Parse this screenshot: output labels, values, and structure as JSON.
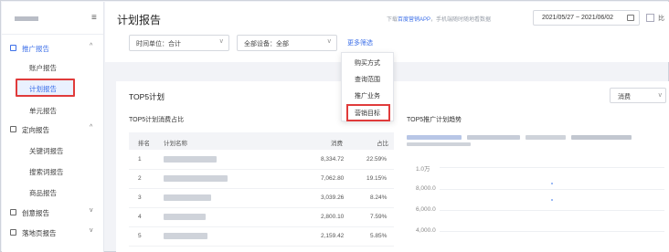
{
  "sidebar": {
    "collapse_icon": "menu-collapse-icon",
    "groups": [
      {
        "label": "推广报告",
        "icon": "chart-icon",
        "expanded": true
      },
      {
        "label": "定向报告",
        "icon": "target-icon",
        "expanded": true
      },
      {
        "label": "创意报告",
        "icon": "creative-icon",
        "expanded": false
      },
      {
        "label": "落地页报告",
        "icon": "page-icon",
        "expanded": false
      }
    ],
    "promo_items": [
      "账户报告",
      "计划报告",
      "单元报告"
    ],
    "targeting_items": [
      "关键词报告",
      "搜索词报告",
      "商品报告"
    ],
    "selected_item": "计划报告"
  },
  "header": {
    "title": "计划报告",
    "hint_prefix": "下载",
    "hint_link": "百度营销APP",
    "hint_suffix": "，手机端随时随地看数据",
    "date_range": "2021/05/27 ~ 2021/06/02",
    "compare_label": "比"
  },
  "filters": {
    "time_unit": "时间单位：合计",
    "device": "全部设备：全部",
    "more": "更多筛选"
  },
  "more_menu": {
    "options": [
      "购买方式",
      "查询范围",
      "推广业务",
      "营销目标"
    ],
    "highlighted": "营销目标"
  },
  "top5": {
    "section_title": "TOP5计划",
    "metric": "消费",
    "table_title": "TOP5计划消费占比",
    "trend_title": "TOP5推广计划趋势",
    "columns": [
      "排名",
      "计划名称",
      "消费",
      "占比"
    ],
    "rows": [
      {
        "rank": "1",
        "spend": "8,334.72",
        "pct": "22.59%"
      },
      {
        "rank": "2",
        "spend": "7,062.80",
        "pct": "19.15%"
      },
      {
        "rank": "3",
        "spend": "3,039.26",
        "pct": "8.24%"
      },
      {
        "rank": "4",
        "spend": "2,800.10",
        "pct": "7.59%"
      },
      {
        "rank": "5",
        "spend": "2,159.42",
        "pct": "5.85%"
      }
    ],
    "y_ticks": [
      "1.0万",
      "8,000.0",
      "6,000.0",
      "4,000.0"
    ],
    "accent_color": "#3c6fe8",
    "highlight_color": "#e03b3b"
  }
}
